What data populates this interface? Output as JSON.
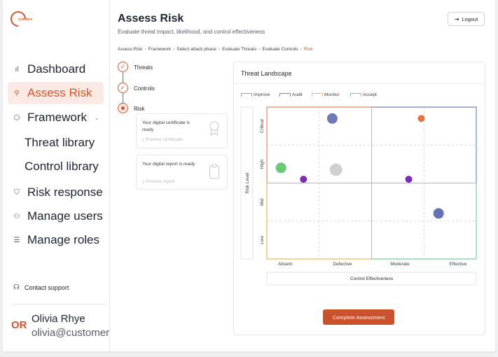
{
  "sidebar": {
    "logo_text": "OVENGA",
    "nav": [
      {
        "label": "Dashboard",
        "icon": "bar-chart-icon"
      },
      {
        "label": "Assess Risk",
        "icon": "search-icon",
        "active": true
      },
      {
        "label": "Framework",
        "icon": "cube-icon"
      },
      {
        "label": "Threat library"
      },
      {
        "label": "Control library"
      },
      {
        "label": "Risk response",
        "icon": "shield-icon"
      },
      {
        "label": "Manage users",
        "icon": "users-icon"
      },
      {
        "label": "Manage roles",
        "icon": "server-icon"
      }
    ],
    "support_label": "Contact support",
    "user": {
      "initials": "OR",
      "name": "Olivia Rhye",
      "email": "olivia@customer.com"
    }
  },
  "header": {
    "title": "Assess Risk",
    "subtitle": "Evaluate threat impact, likelihood, and control effectiveness",
    "logout_label": "Logout",
    "breadcrumb": [
      "Assess Risk",
      "Framework",
      "Select attack phase",
      "Evaluate Threats",
      "Evaluate Controls",
      "Risk"
    ]
  },
  "steps": [
    {
      "label": "Threats",
      "status": "done"
    },
    {
      "label": "Controls",
      "status": "done"
    },
    {
      "label": "Risk",
      "status": "current"
    }
  ],
  "cards": [
    {
      "title": "Your digital certificate is ready",
      "action": "Preview certificate",
      "icon": "award-icon"
    },
    {
      "title": "Your digital report is ready",
      "action": "Preview report",
      "icon": "clipboard-icon"
    }
  ],
  "landscape": {
    "title": "Threat Landscape",
    "legend": [
      {
        "label": "Improve",
        "color": "#e8865c"
      },
      {
        "label": "Audit",
        "color": "#6b85c9"
      },
      {
        "label": "Monitor",
        "color": "#f0b964"
      },
      {
        "label": "Accept",
        "color": "#71d39a"
      }
    ]
  },
  "chart_data": {
    "type": "scatter",
    "title": "Threat Landscape",
    "xlabel": "Control Effectiveness",
    "ylabel": "Risk Level",
    "x_categories": [
      "Absent",
      "Defective",
      "Moderate",
      "Effective"
    ],
    "y_categories": [
      "Low",
      "Mid",
      "High",
      "Critical"
    ],
    "xlim": [
      0,
      4
    ],
    "ylim": [
      0,
      4
    ],
    "quadrants": {
      "top_left": "Improve",
      "top_right": "Audit",
      "bottom_left": "Monitor",
      "bottom_right": "Accept"
    },
    "points": [
      {
        "x": 1.25,
        "y": 3.7,
        "size": "medium",
        "color": "#7079b8"
      },
      {
        "x": 2.95,
        "y": 3.7,
        "size": "small",
        "color": "#e8733c"
      },
      {
        "x": 0.27,
        "y": 2.4,
        "size": "medium",
        "color": "#6cca76"
      },
      {
        "x": 1.32,
        "y": 2.35,
        "size": "large",
        "color": "#d0d0d3"
      },
      {
        "x": 0.7,
        "y": 2.1,
        "size": "small",
        "color": "#7b2bb8"
      },
      {
        "x": 2.71,
        "y": 2.1,
        "size": "small",
        "color": "#7b2bb8"
      },
      {
        "x": 3.28,
        "y": 1.2,
        "size": "medium",
        "color": "#6672b8"
      }
    ]
  },
  "actions": {
    "complete_label": "Complete Assessment"
  }
}
